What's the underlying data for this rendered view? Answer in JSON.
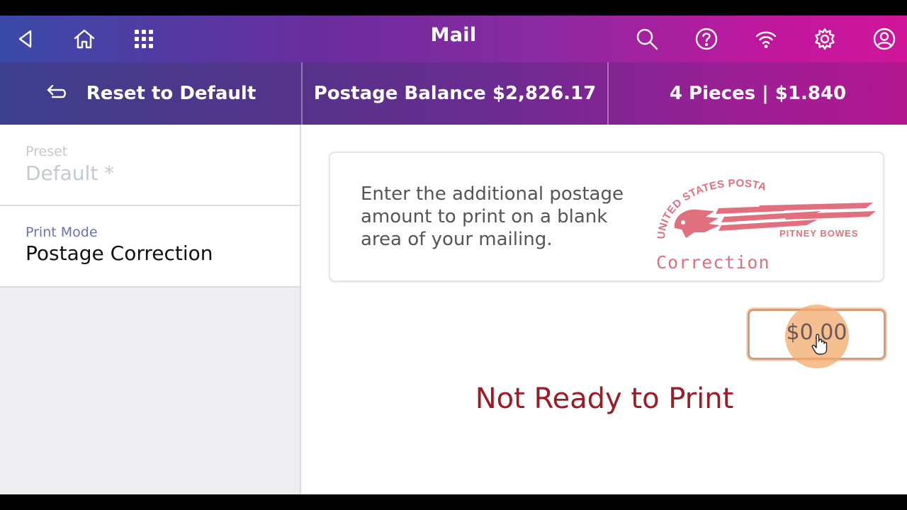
{
  "topbar": {
    "title": "Mail",
    "icons": [
      "back-icon",
      "home-icon",
      "apps-grid-icon",
      "search-icon",
      "help-icon",
      "wifi-icon",
      "gear-icon",
      "account-icon"
    ]
  },
  "infobar": {
    "reset_label": "Reset to Default",
    "balance": "Postage Balance $2,826.17",
    "pieces": "4 Pieces | $1.840"
  },
  "sidebar": {
    "preset": {
      "label": "Preset",
      "value": "Default *"
    },
    "print_mode": {
      "label": "Print Mode",
      "value": "Postage Correction"
    }
  },
  "main": {
    "instruction": "Enter the additional postage amount to print on a blank area of your mailing.",
    "stamp": {
      "arc_text": "UNITED STATES POSTAGE",
      "brand": "PITNEY BOWES",
      "caption": "Correction"
    },
    "amount": "$0.00",
    "status": "Not Ready to Print"
  },
  "colors": {
    "status": "#9b1b26",
    "stamp": "#e0707d",
    "field_border": "#d99a76",
    "accent_purple": "#6c71b8"
  }
}
